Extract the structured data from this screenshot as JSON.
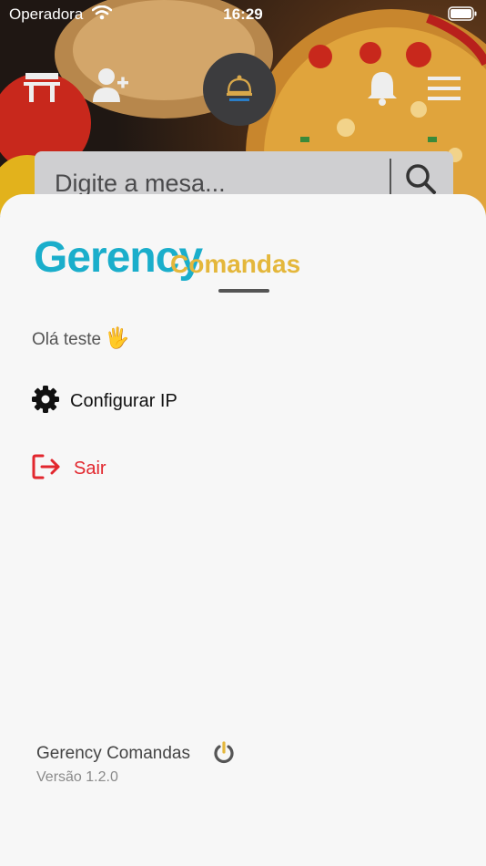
{
  "status_bar": {
    "carrier": "Operadora",
    "time": "16:29"
  },
  "toolbar": {
    "icons": [
      "table-icon",
      "add-user-icon",
      "service-bell-icon",
      "bell-icon",
      "menu-icon"
    ]
  },
  "search": {
    "placeholder": "Digite a mesa..."
  },
  "drawer": {
    "logo_primary": "Gerency",
    "logo_secondary": "Comandas",
    "greeting": "Olá teste",
    "greeting_emoji": "🖐",
    "menu": [
      {
        "label": "Configurar IP",
        "icon": "gear-icon"
      },
      {
        "label": "Sair",
        "icon": "logout-icon",
        "color": "#e2272e"
      }
    ],
    "footer_app_name": "Gerency Comandas",
    "footer_version": "Versão 1.2.0"
  },
  "colors": {
    "logo_blue": "#1aaecb",
    "logo_gold": "#e4b73b",
    "danger": "#e2272e",
    "sheet_bg": "#f7f7f7"
  }
}
